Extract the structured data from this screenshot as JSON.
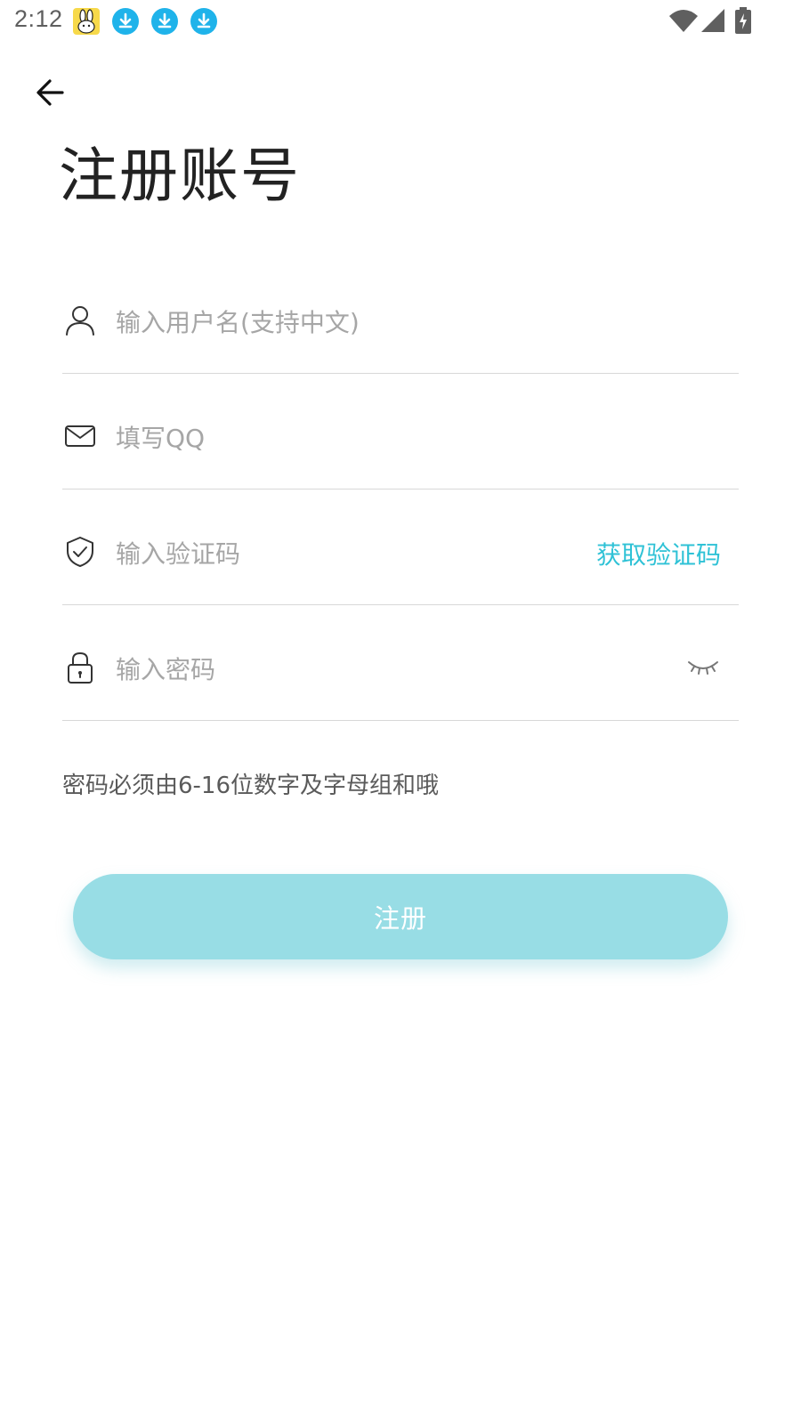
{
  "status_bar": {
    "time": "2:12",
    "icons": [
      "bunny-app-icon",
      "download-icon",
      "download-icon",
      "download-icon",
      "wifi-icon",
      "signal-icon",
      "battery-charging-icon"
    ]
  },
  "header": {
    "back_icon": "arrow-left-icon",
    "title": "注册账号"
  },
  "form": {
    "username": {
      "icon": "user-icon",
      "placeholder": "输入用户名(支持中文)",
      "value": ""
    },
    "qq": {
      "icon": "mail-icon",
      "placeholder": "填写QQ",
      "value": ""
    },
    "code": {
      "icon": "shield-check-icon",
      "placeholder": "输入验证码",
      "value": "",
      "action_label": "获取验证码"
    },
    "password": {
      "icon": "lock-icon",
      "placeholder": "输入密码",
      "value": "",
      "toggle_icon": "eye-closed-icon"
    }
  },
  "hint": "密码必须由6-16位数字及字母组和哦",
  "submit": {
    "label": "注册"
  },
  "colors": {
    "accent": "#2fc2d6",
    "button_bg": "#98dde5",
    "divider": "#d8d8d8",
    "placeholder": "#a6a6a6"
  }
}
